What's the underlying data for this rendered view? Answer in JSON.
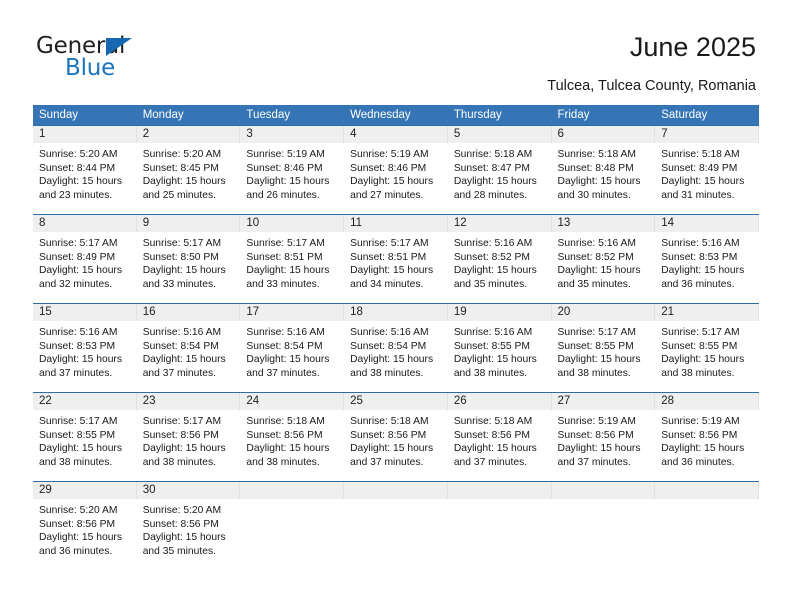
{
  "brand": {
    "name_top": "General",
    "name_bottom": "Blue",
    "accent_color": "#1c75bc"
  },
  "header": {
    "title": "June 2025",
    "subtitle": "Tulcea, Tulcea County, Romania"
  },
  "theme": {
    "header_blue": "#3575b5",
    "row_divider_blue": "#2e6da4",
    "daynum_band": "#efefef"
  },
  "weekdays": [
    "Sunday",
    "Monday",
    "Tuesday",
    "Wednesday",
    "Thursday",
    "Friday",
    "Saturday"
  ],
  "weeks": [
    [
      {
        "day": "1",
        "sunrise": "Sunrise: 5:20 AM",
        "sunset": "Sunset: 8:44 PM",
        "daylight1": "Daylight: 15 hours",
        "daylight2": "and 23 minutes."
      },
      {
        "day": "2",
        "sunrise": "Sunrise: 5:20 AM",
        "sunset": "Sunset: 8:45 PM",
        "daylight1": "Daylight: 15 hours",
        "daylight2": "and 25 minutes."
      },
      {
        "day": "3",
        "sunrise": "Sunrise: 5:19 AM",
        "sunset": "Sunset: 8:46 PM",
        "daylight1": "Daylight: 15 hours",
        "daylight2": "and 26 minutes."
      },
      {
        "day": "4",
        "sunrise": "Sunrise: 5:19 AM",
        "sunset": "Sunset: 8:46 PM",
        "daylight1": "Daylight: 15 hours",
        "daylight2": "and 27 minutes."
      },
      {
        "day": "5",
        "sunrise": "Sunrise: 5:18 AM",
        "sunset": "Sunset: 8:47 PM",
        "daylight1": "Daylight: 15 hours",
        "daylight2": "and 28 minutes."
      },
      {
        "day": "6",
        "sunrise": "Sunrise: 5:18 AM",
        "sunset": "Sunset: 8:48 PM",
        "daylight1": "Daylight: 15 hours",
        "daylight2": "and 30 minutes."
      },
      {
        "day": "7",
        "sunrise": "Sunrise: 5:18 AM",
        "sunset": "Sunset: 8:49 PM",
        "daylight1": "Daylight: 15 hours",
        "daylight2": "and 31 minutes."
      }
    ],
    [
      {
        "day": "8",
        "sunrise": "Sunrise: 5:17 AM",
        "sunset": "Sunset: 8:49 PM",
        "daylight1": "Daylight: 15 hours",
        "daylight2": "and 32 minutes."
      },
      {
        "day": "9",
        "sunrise": "Sunrise: 5:17 AM",
        "sunset": "Sunset: 8:50 PM",
        "daylight1": "Daylight: 15 hours",
        "daylight2": "and 33 minutes."
      },
      {
        "day": "10",
        "sunrise": "Sunrise: 5:17 AM",
        "sunset": "Sunset: 8:51 PM",
        "daylight1": "Daylight: 15 hours",
        "daylight2": "and 33 minutes."
      },
      {
        "day": "11",
        "sunrise": "Sunrise: 5:17 AM",
        "sunset": "Sunset: 8:51 PM",
        "daylight1": "Daylight: 15 hours",
        "daylight2": "and 34 minutes."
      },
      {
        "day": "12",
        "sunrise": "Sunrise: 5:16 AM",
        "sunset": "Sunset: 8:52 PM",
        "daylight1": "Daylight: 15 hours",
        "daylight2": "and 35 minutes."
      },
      {
        "day": "13",
        "sunrise": "Sunrise: 5:16 AM",
        "sunset": "Sunset: 8:52 PM",
        "daylight1": "Daylight: 15 hours",
        "daylight2": "and 35 minutes."
      },
      {
        "day": "14",
        "sunrise": "Sunrise: 5:16 AM",
        "sunset": "Sunset: 8:53 PM",
        "daylight1": "Daylight: 15 hours",
        "daylight2": "and 36 minutes."
      }
    ],
    [
      {
        "day": "15",
        "sunrise": "Sunrise: 5:16 AM",
        "sunset": "Sunset: 8:53 PM",
        "daylight1": "Daylight: 15 hours",
        "daylight2": "and 37 minutes."
      },
      {
        "day": "16",
        "sunrise": "Sunrise: 5:16 AM",
        "sunset": "Sunset: 8:54 PM",
        "daylight1": "Daylight: 15 hours",
        "daylight2": "and 37 minutes."
      },
      {
        "day": "17",
        "sunrise": "Sunrise: 5:16 AM",
        "sunset": "Sunset: 8:54 PM",
        "daylight1": "Daylight: 15 hours",
        "daylight2": "and 37 minutes."
      },
      {
        "day": "18",
        "sunrise": "Sunrise: 5:16 AM",
        "sunset": "Sunset: 8:54 PM",
        "daylight1": "Daylight: 15 hours",
        "daylight2": "and 38 minutes."
      },
      {
        "day": "19",
        "sunrise": "Sunrise: 5:16 AM",
        "sunset": "Sunset: 8:55 PM",
        "daylight1": "Daylight: 15 hours",
        "daylight2": "and 38 minutes."
      },
      {
        "day": "20",
        "sunrise": "Sunrise: 5:17 AM",
        "sunset": "Sunset: 8:55 PM",
        "daylight1": "Daylight: 15 hours",
        "daylight2": "and 38 minutes."
      },
      {
        "day": "21",
        "sunrise": "Sunrise: 5:17 AM",
        "sunset": "Sunset: 8:55 PM",
        "daylight1": "Daylight: 15 hours",
        "daylight2": "and 38 minutes."
      }
    ],
    [
      {
        "day": "22",
        "sunrise": "Sunrise: 5:17 AM",
        "sunset": "Sunset: 8:55 PM",
        "daylight1": "Daylight: 15 hours",
        "daylight2": "and 38 minutes."
      },
      {
        "day": "23",
        "sunrise": "Sunrise: 5:17 AM",
        "sunset": "Sunset: 8:56 PM",
        "daylight1": "Daylight: 15 hours",
        "daylight2": "and 38 minutes."
      },
      {
        "day": "24",
        "sunrise": "Sunrise: 5:18 AM",
        "sunset": "Sunset: 8:56 PM",
        "daylight1": "Daylight: 15 hours",
        "daylight2": "and 38 minutes."
      },
      {
        "day": "25",
        "sunrise": "Sunrise: 5:18 AM",
        "sunset": "Sunset: 8:56 PM",
        "daylight1": "Daylight: 15 hours",
        "daylight2": "and 37 minutes."
      },
      {
        "day": "26",
        "sunrise": "Sunrise: 5:18 AM",
        "sunset": "Sunset: 8:56 PM",
        "daylight1": "Daylight: 15 hours",
        "daylight2": "and 37 minutes."
      },
      {
        "day": "27",
        "sunrise": "Sunrise: 5:19 AM",
        "sunset": "Sunset: 8:56 PM",
        "daylight1": "Daylight: 15 hours",
        "daylight2": "and 37 minutes."
      },
      {
        "day": "28",
        "sunrise": "Sunrise: 5:19 AM",
        "sunset": "Sunset: 8:56 PM",
        "daylight1": "Daylight: 15 hours",
        "daylight2": "and 36 minutes."
      }
    ],
    [
      {
        "day": "29",
        "sunrise": "Sunrise: 5:20 AM",
        "sunset": "Sunset: 8:56 PM",
        "daylight1": "Daylight: 15 hours",
        "daylight2": "and 36 minutes."
      },
      {
        "day": "30",
        "sunrise": "Sunrise: 5:20 AM",
        "sunset": "Sunset: 8:56 PM",
        "daylight1": "Daylight: 15 hours",
        "daylight2": "and 35 minutes."
      },
      {
        "day": "",
        "sunrise": "",
        "sunset": "",
        "daylight1": "",
        "daylight2": ""
      },
      {
        "day": "",
        "sunrise": "",
        "sunset": "",
        "daylight1": "",
        "daylight2": ""
      },
      {
        "day": "",
        "sunrise": "",
        "sunset": "",
        "daylight1": "",
        "daylight2": ""
      },
      {
        "day": "",
        "sunrise": "",
        "sunset": "",
        "daylight1": "",
        "daylight2": ""
      },
      {
        "day": "",
        "sunrise": "",
        "sunset": "",
        "daylight1": "",
        "daylight2": ""
      }
    ]
  ]
}
